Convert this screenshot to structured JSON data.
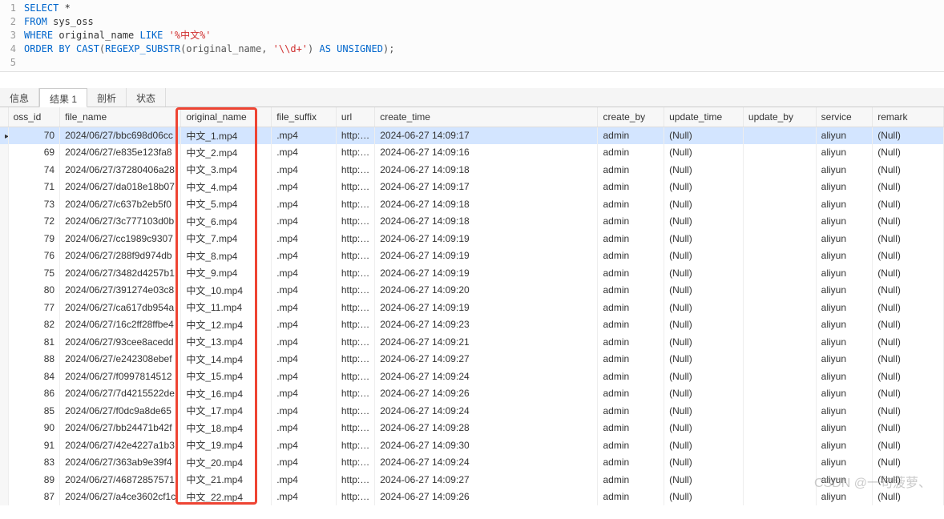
{
  "sql": {
    "line1_kw1": "SELECT",
    "line1_rest": " *",
    "line2_kw": "FROM",
    "line2_rest": " sys_oss",
    "line3_kw1": "WHERE",
    "line3_rest1": " original_name ",
    "line3_kw2": "LIKE",
    "line3_str": " '%中文%'",
    "line4_kw1": "ORDER BY",
    "line4_func1": " CAST",
    "line4_paren1": "(",
    "line4_func2": "REGEXP_SUBSTR",
    "line4_paren2": "(original_name, ",
    "line4_str": "'\\\\d+'",
    "line4_paren3": ") ",
    "line4_kw2": "AS",
    "line4_kw3": " UNSIGNED",
    "line4_paren4": ");"
  },
  "line_nums": [
    "1",
    "2",
    "3",
    "4",
    "5"
  ],
  "tabs": {
    "info": "信息",
    "result": "结果 1",
    "profile": "剖析",
    "status": "状态"
  },
  "headers": {
    "oss_id": "oss_id",
    "file_name": "file_name",
    "original_name": "original_name",
    "file_suffix": "file_suffix",
    "url": "url",
    "create_time": "create_time",
    "create_by": "create_by",
    "update_time": "update_time",
    "update_by": "update_by",
    "service": "service",
    "remark": "remark"
  },
  "null_text": "(Null)",
  "rows": [
    {
      "oss_id": "70",
      "file_name": "2024/06/27/bbc698d06cc",
      "original_name": "中文_1.mp4",
      "file_suffix": ".mp4",
      "url": "http://v",
      "create_time": "2024-06-27 14:09:17",
      "create_by": "admin",
      "service": "aliyun",
      "selected": true
    },
    {
      "oss_id": "69",
      "file_name": "2024/06/27/e835e123fa8",
      "original_name": "中文_2.mp4",
      "file_suffix": ".mp4",
      "url": "http://v",
      "create_time": "2024-06-27 14:09:16",
      "create_by": "admin",
      "service": "aliyun"
    },
    {
      "oss_id": "74",
      "file_name": "2024/06/27/37280406a28",
      "original_name": "中文_3.mp4",
      "file_suffix": ".mp4",
      "url": "http://v",
      "create_time": "2024-06-27 14:09:18",
      "create_by": "admin",
      "service": "aliyun"
    },
    {
      "oss_id": "71",
      "file_name": "2024/06/27/da018e18b07",
      "original_name": "中文_4.mp4",
      "file_suffix": ".mp4",
      "url": "http://v",
      "create_time": "2024-06-27 14:09:17",
      "create_by": "admin",
      "service": "aliyun"
    },
    {
      "oss_id": "73",
      "file_name": "2024/06/27/c637b2eb5f0",
      "original_name": "中文_5.mp4",
      "file_suffix": ".mp4",
      "url": "http://v",
      "create_time": "2024-06-27 14:09:18",
      "create_by": "admin",
      "service": "aliyun"
    },
    {
      "oss_id": "72",
      "file_name": "2024/06/27/3c777103d0b",
      "original_name": "中文_6.mp4",
      "file_suffix": ".mp4",
      "url": "http://v",
      "create_time": "2024-06-27 14:09:18",
      "create_by": "admin",
      "service": "aliyun"
    },
    {
      "oss_id": "79",
      "file_name": "2024/06/27/cc1989c9307",
      "original_name": "中文_7.mp4",
      "file_suffix": ".mp4",
      "url": "http://v",
      "create_time": "2024-06-27 14:09:19",
      "create_by": "admin",
      "service": "aliyun"
    },
    {
      "oss_id": "76",
      "file_name": "2024/06/27/288f9d974db",
      "original_name": "中文_8.mp4",
      "file_suffix": ".mp4",
      "url": "http://v",
      "create_time": "2024-06-27 14:09:19",
      "create_by": "admin",
      "service": "aliyun"
    },
    {
      "oss_id": "75",
      "file_name": "2024/06/27/3482d4257b1",
      "original_name": "中文_9.mp4",
      "file_suffix": ".mp4",
      "url": "http://v",
      "create_time": "2024-06-27 14:09:19",
      "create_by": "admin",
      "service": "aliyun"
    },
    {
      "oss_id": "80",
      "file_name": "2024/06/27/391274e03c8",
      "original_name": "中文_10.mp4",
      "file_suffix": ".mp4",
      "url": "http://v",
      "create_time": "2024-06-27 14:09:20",
      "create_by": "admin",
      "service": "aliyun"
    },
    {
      "oss_id": "77",
      "file_name": "2024/06/27/ca617db954a",
      "original_name": "中文_11.mp4",
      "file_suffix": ".mp4",
      "url": "http://v",
      "create_time": "2024-06-27 14:09:19",
      "create_by": "admin",
      "service": "aliyun"
    },
    {
      "oss_id": "82",
      "file_name": "2024/06/27/16c2ff28ffbe4",
      "original_name": "中文_12.mp4",
      "file_suffix": ".mp4",
      "url": "http://v",
      "create_time": "2024-06-27 14:09:23",
      "create_by": "admin",
      "service": "aliyun"
    },
    {
      "oss_id": "81",
      "file_name": "2024/06/27/93cee8acedd",
      "original_name": "中文_13.mp4",
      "file_suffix": ".mp4",
      "url": "http://v",
      "create_time": "2024-06-27 14:09:21",
      "create_by": "admin",
      "service": "aliyun"
    },
    {
      "oss_id": "88",
      "file_name": "2024/06/27/e242308ebef",
      "original_name": "中文_14.mp4",
      "file_suffix": ".mp4",
      "url": "http://v",
      "create_time": "2024-06-27 14:09:27",
      "create_by": "admin",
      "service": "aliyun"
    },
    {
      "oss_id": "84",
      "file_name": "2024/06/27/f0997814512",
      "original_name": "中文_15.mp4",
      "file_suffix": ".mp4",
      "url": "http://v",
      "create_time": "2024-06-27 14:09:24",
      "create_by": "admin",
      "service": "aliyun"
    },
    {
      "oss_id": "86",
      "file_name": "2024/06/27/7d4215522de",
      "original_name": "中文_16.mp4",
      "file_suffix": ".mp4",
      "url": "http://v",
      "create_time": "2024-06-27 14:09:26",
      "create_by": "admin",
      "service": "aliyun"
    },
    {
      "oss_id": "85",
      "file_name": "2024/06/27/f0dc9a8de65",
      "original_name": "中文_17.mp4",
      "file_suffix": ".mp4",
      "url": "http://v",
      "create_time": "2024-06-27 14:09:24",
      "create_by": "admin",
      "service": "aliyun"
    },
    {
      "oss_id": "90",
      "file_name": "2024/06/27/bb24471b42f",
      "original_name": "中文_18.mp4",
      "file_suffix": ".mp4",
      "url": "http://v",
      "create_time": "2024-06-27 14:09:28",
      "create_by": "admin",
      "service": "aliyun"
    },
    {
      "oss_id": "91",
      "file_name": "2024/06/27/42e4227a1b3",
      "original_name": "中文_19.mp4",
      "file_suffix": ".mp4",
      "url": "http://v",
      "create_time": "2024-06-27 14:09:30",
      "create_by": "admin",
      "service": "aliyun"
    },
    {
      "oss_id": "83",
      "file_name": "2024/06/27/363ab9e39f4",
      "original_name": "中文_20.mp4",
      "file_suffix": ".mp4",
      "url": "http://v",
      "create_time": "2024-06-27 14:09:24",
      "create_by": "admin",
      "service": "aliyun"
    },
    {
      "oss_id": "89",
      "file_name": "2024/06/27/46872857571",
      "original_name": "中文_21.mp4",
      "file_suffix": ".mp4",
      "url": "http://v",
      "create_time": "2024-06-27 14:09:27",
      "create_by": "admin",
      "service": "aliyun"
    },
    {
      "oss_id": "87",
      "file_name": "2024/06/27/a4ce3602cf1c",
      "original_name": "中文_22.mp4",
      "file_suffix": ".mp4",
      "url": "http://v",
      "create_time": "2024-06-27 14:09:26",
      "create_by": "admin",
      "service": "aliyun"
    }
  ],
  "watermark": "CSDN @一句菠萝、"
}
